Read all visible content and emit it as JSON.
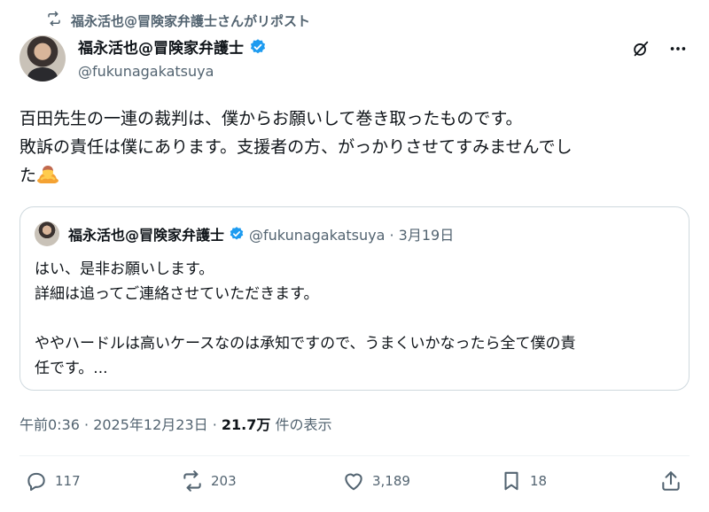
{
  "repost": {
    "text": "福永活也@冒険家弁護士さんがリポスト"
  },
  "post": {
    "author_name": "福永活也@冒険家弁護士",
    "author_handle": "@fukunagakatsuya",
    "lines": [
      "百田先生の一連の裁判は、僕からお願いして巻き取ったものです。",
      "敗訴の責任は僕にあります。支援者の方、がっかりさせてすみませんでし",
      "た"
    ],
    "emoji": "person-bowing-emoji"
  },
  "quote": {
    "author_name": "福永活也@冒険家弁護士",
    "meta": "@fukunagakatsuya · 3月19日",
    "lines": [
      "はい、是非お願いします。",
      "詳細は追ってご連絡させていただきます。",
      "ややハードルは高いケースなのは承知ですので、うまくいかなったら全て僕の責",
      "任です。..."
    ]
  },
  "meta": {
    "time": "午前0:36 · 2025年12月23日 · ",
    "views": "21.7万",
    "views_label": " 件の表示"
  },
  "actions": {
    "replies": "117",
    "reposts": "203",
    "likes": "3,189",
    "bookmarks": "18"
  },
  "colors": {
    "text": "#0f1419",
    "secondary": "#536471",
    "verified": "#1d9bf0",
    "border": "#cfd9de"
  }
}
